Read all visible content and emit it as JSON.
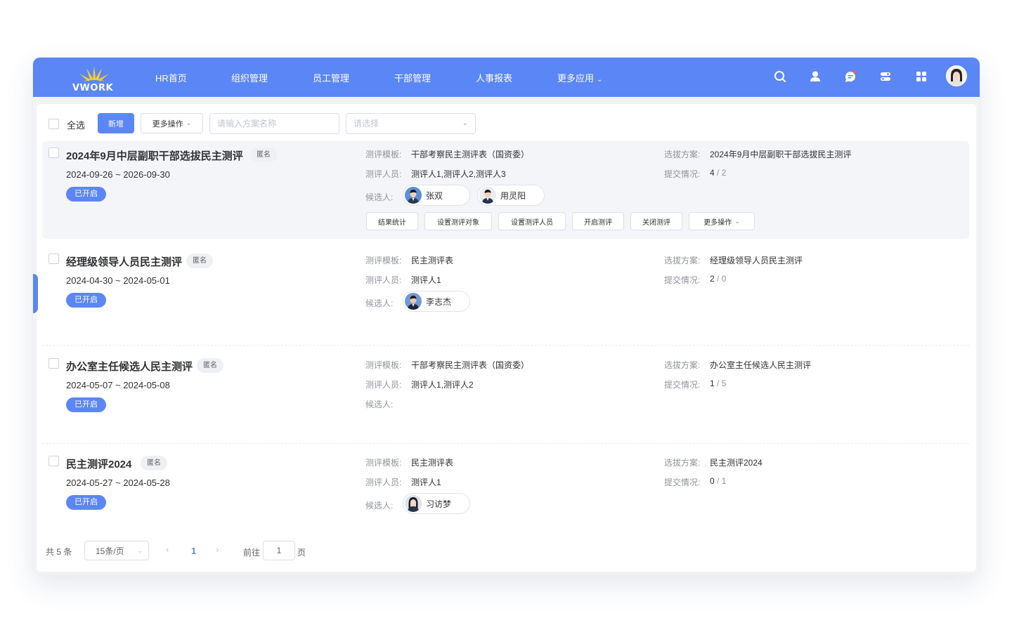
{
  "app": {
    "brand": "VWORK",
    "nav": [
      {
        "label": "HR首页"
      },
      {
        "label": "组织管理"
      },
      {
        "label": "员工管理"
      },
      {
        "label": "干部管理"
      },
      {
        "label": "人事报表"
      },
      {
        "label": "更多应用"
      }
    ],
    "top_icons": [
      "search-icon",
      "user-icon",
      "chat-icon",
      "toggle-icon",
      "apps-grid-icon"
    ],
    "accent_color": "#5b86f5"
  },
  "toolbar": {
    "select_all": "全选",
    "add_button": "新增",
    "more_actions": "更多操作",
    "name_placeholder": "请输入方案名称",
    "select_placeholder": "请选择"
  },
  "labels": {
    "template": "测评模板:",
    "evaluators": "测评人员:",
    "candidates": "候选人:",
    "plan": "选拔方案:",
    "submission": "提交情况:"
  },
  "records": [
    {
      "title": "2024年9月中层副职干部选拔民主测评",
      "tag": "匿名",
      "date_range": "2024-09-26 ~ 2026-09-30",
      "status": "已开启",
      "template": "干部考察民主测评表（国资委）",
      "evaluators": "测评人1,测评人2,测评人3",
      "candidates": [
        {
          "name": "张双"
        },
        {
          "name": "用灵阳"
        }
      ],
      "plan": "2024年9月中层副职干部选拔民主测评",
      "submitted": "4",
      "sep": "/",
      "total": "2",
      "actions": [
        "结果统计",
        "设置测评对象",
        "设置测评人员",
        "开启测评",
        "关闭测评",
        "更多操作"
      ]
    },
    {
      "title": "经理级领导人员民主测评",
      "tag": "匿名",
      "date_range": "2024-04-30 ~ 2024-05-01",
      "status": "已开启",
      "template": "民主测评表",
      "evaluators": "测评人1",
      "candidates": [
        {
          "name": "李志杰"
        }
      ],
      "plan": "经理级领导人员民主测评",
      "submitted": "2",
      "sep": "/",
      "total": "0"
    },
    {
      "title": "办公室主任候选人民主测评",
      "tag": "匿名",
      "date_range": "2024-05-07 ~ 2024-05-08",
      "status": "已开启",
      "template": "干部考察民主测评表（国资委）",
      "evaluators": "测评人1,测评人2",
      "candidates": [],
      "plan": "办公室主任候选人民主测评",
      "submitted": "1",
      "sep": "/",
      "total": "5"
    },
    {
      "title": "民主测评2024",
      "tag": "匿名",
      "date_range": "2024-05-27 ~ 2024-05-28",
      "status": "已开启",
      "template": "民主测评表",
      "evaluators": "测评人1",
      "candidates": [
        {
          "name": "习访梦"
        }
      ],
      "plan": "民主测评2024",
      "submitted": "0",
      "sep": "/",
      "total": "1"
    }
  ],
  "pagination": {
    "total_text": "共 5 条",
    "page_size": "15条/页",
    "current_page": "1",
    "goto_label": "前往",
    "goto_value": "1",
    "page_suffix": "页"
  }
}
